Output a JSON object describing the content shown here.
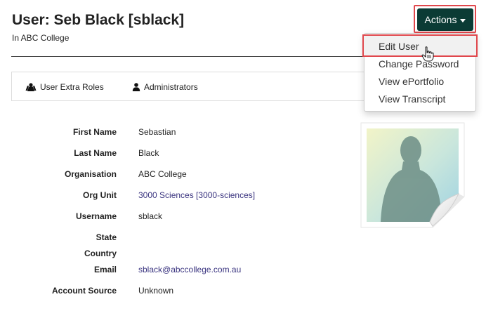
{
  "header": {
    "title": "User: Seb Black [sblack]",
    "subtitle": "In ABC College"
  },
  "actions": {
    "button_label": "Actions",
    "menu": [
      {
        "label": "Edit User"
      },
      {
        "label": "Change Password"
      },
      {
        "label": "View ePortfolio"
      },
      {
        "label": "View Transcript"
      }
    ]
  },
  "tabs": [
    {
      "label": "User Extra Roles",
      "icon": "user-extra-roles-icon"
    },
    {
      "label": "Administrators",
      "icon": "user-icon"
    }
  ],
  "details": [
    {
      "label": "First Name",
      "value": "Sebastian"
    },
    {
      "label": "Last Name",
      "value": "Black"
    },
    {
      "label": "Organisation",
      "value": "ABC College"
    },
    {
      "label": "Org Unit",
      "value": "3000 Sciences [3000-sciences]"
    },
    {
      "label": "Username",
      "value": "sblack"
    },
    {
      "label": "State",
      "value": ""
    },
    {
      "label": "Country",
      "value": ""
    },
    {
      "label": "Email",
      "value": "sblack@abccollege.com.au"
    },
    {
      "label": "Account Source",
      "value": "Unknown"
    }
  ],
  "colors": {
    "actions_button": "#0b3b35",
    "highlight_border": "#e0474c",
    "link": "#3b3580"
  },
  "photo": {
    "icon": "profile-photo-placeholder"
  }
}
